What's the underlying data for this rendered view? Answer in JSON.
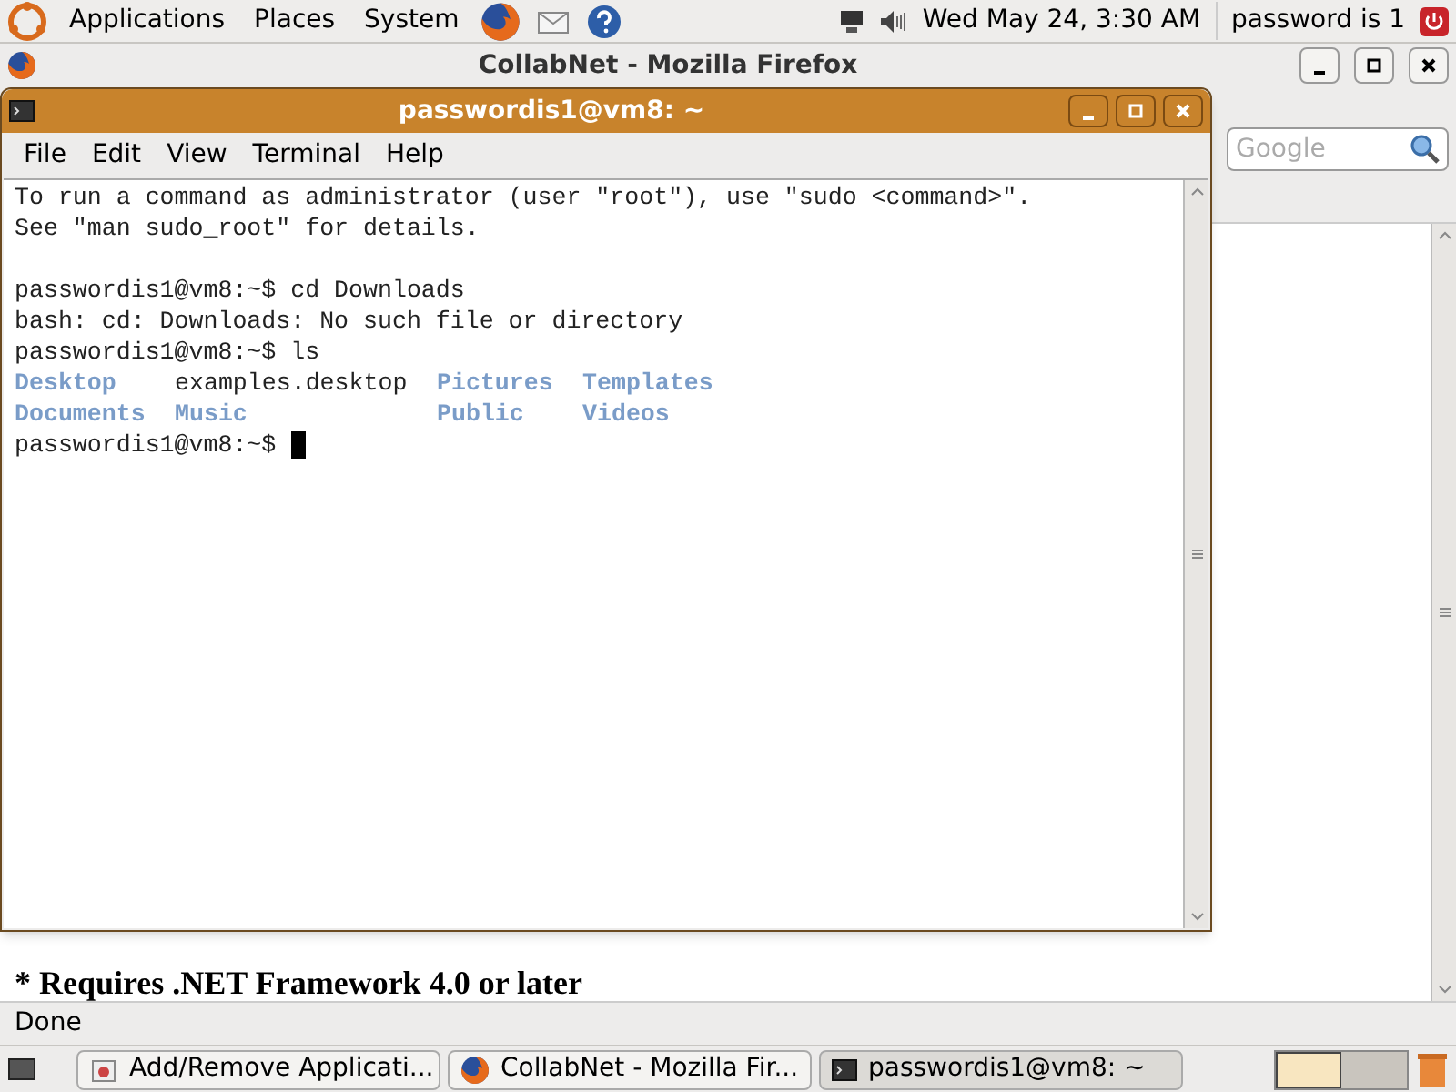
{
  "top_panel": {
    "menus": [
      "Applications",
      "Places",
      "System"
    ],
    "clock": "Wed May 24,  3:30 AM",
    "user": "password is 1"
  },
  "firefox": {
    "title": "CollabNet - Mozilla Firefox",
    "search": {
      "placeholder": "Google"
    },
    "page_text": "* Requires .NET Framework 4.0 or later",
    "status": "Done"
  },
  "terminal": {
    "title": "passwordis1@vm8: ~",
    "menus": [
      "File",
      "Edit",
      "View",
      "Terminal",
      "Help"
    ],
    "lines": [
      {
        "kind": "text",
        "text": "To run a command as administrator (user \"root\"), use \"sudo <command>\"."
      },
      {
        "kind": "text",
        "text": "See \"man sudo_root\" for details."
      },
      {
        "kind": "blank"
      },
      {
        "kind": "text",
        "text": "passwordis1@vm8:~$ cd Downloads"
      },
      {
        "kind": "text",
        "text": "bash: cd: Downloads: No such file or directory"
      },
      {
        "kind": "text",
        "text": "passwordis1@vm8:~$ ls"
      },
      {
        "kind": "listing",
        "cells": [
          {
            "text": "Desktop",
            "kind": "dir"
          },
          {
            "text": "examples.desktop",
            "kind": "file"
          },
          {
            "text": "Pictures",
            "kind": "dir"
          },
          {
            "text": "Templates",
            "kind": "dir"
          }
        ]
      },
      {
        "kind": "listing",
        "cells": [
          {
            "text": "Documents",
            "kind": "dir"
          },
          {
            "text": "Music",
            "kind": "dir"
          },
          {
            "text": "Public",
            "kind": "dir"
          },
          {
            "text": "Videos",
            "kind": "dir"
          }
        ]
      },
      {
        "kind": "prompt",
        "text": "passwordis1@vm8:~$ "
      }
    ]
  },
  "taskbar": [
    {
      "label": "Add/Remove Applicati...",
      "kind": "installer",
      "selected": false
    },
    {
      "label": "CollabNet - Mozilla Fir...",
      "kind": "firefox",
      "selected": false
    },
    {
      "label": "passwordis1@vm8: ~",
      "kind": "terminal",
      "selected": true
    }
  ]
}
